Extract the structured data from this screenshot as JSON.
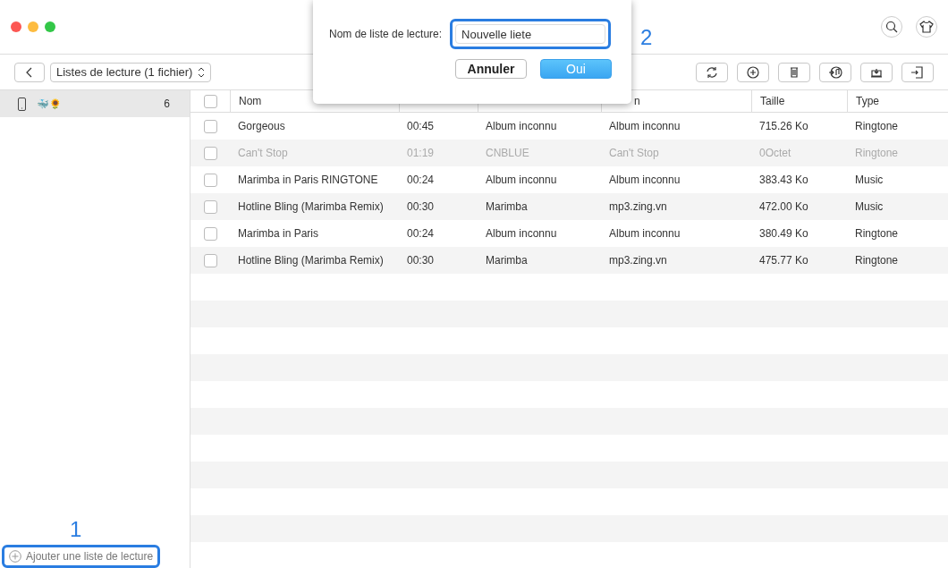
{
  "toolbar": {
    "playlist_selector": "Listes de lecture (1 fichier)"
  },
  "sidebar": {
    "device": {
      "emoji": "🐳🌻",
      "count": "6",
      "selected": true
    },
    "add_button": {
      "label": "Ajouter une liste de lecture",
      "highlighted": true,
      "callout": "1"
    }
  },
  "table": {
    "select_all": {
      "checked": false
    },
    "columns": [
      {
        "label": "Nom"
      },
      {},
      {},
      {
        "label": "n"
      },
      {
        "label": "Taille"
      },
      {
        "label": "Type"
      }
    ],
    "rows": [
      {
        "checked": false,
        "disabled": false,
        "cells": [
          "Gorgeous",
          "00:45",
          "Album inconnu",
          "Album inconnu",
          "715.26 Ko",
          "Ringtone"
        ]
      },
      {
        "checked": false,
        "disabled": true,
        "cells": [
          "Can't Stop",
          "01:19",
          "CNBLUE",
          "Can't Stop",
          "0Octet",
          "Ringtone"
        ]
      },
      {
        "checked": false,
        "disabled": false,
        "cells": [
          "Marimba in Paris RINGTONE",
          "00:24",
          "Album inconnu",
          "Album inconnu",
          "383.43 Ko",
          "Music"
        ]
      },
      {
        "checked": false,
        "disabled": false,
        "cells": [
          "Hotline Bling (Marimba Remix)",
          "00:30",
          "Marimba",
          "mp3.zing.vn",
          "472.00 Ko",
          "Music"
        ]
      },
      {
        "checked": false,
        "disabled": false,
        "cells": [
          "Marimba in Paris",
          "00:24",
          "Album inconnu",
          "Album inconnu",
          "380.49 Ko",
          "Ringtone"
        ]
      },
      {
        "checked": false,
        "disabled": false,
        "cells": [
          "Hotline Bling (Marimba Remix)",
          "00:30",
          "Marimba",
          "mp3.zing.vn",
          "475.77 Ko",
          "Ringtone"
        ]
      }
    ]
  },
  "dialog": {
    "label": "Nom de liste de lecture:",
    "field": {
      "value": "Nouvelle liete",
      "highlighted": true,
      "callout": "2"
    },
    "buttons": [
      {
        "label": "Annuler",
        "kind": "cancel"
      },
      {
        "label": "Oui",
        "kind": "default"
      }
    ]
  }
}
